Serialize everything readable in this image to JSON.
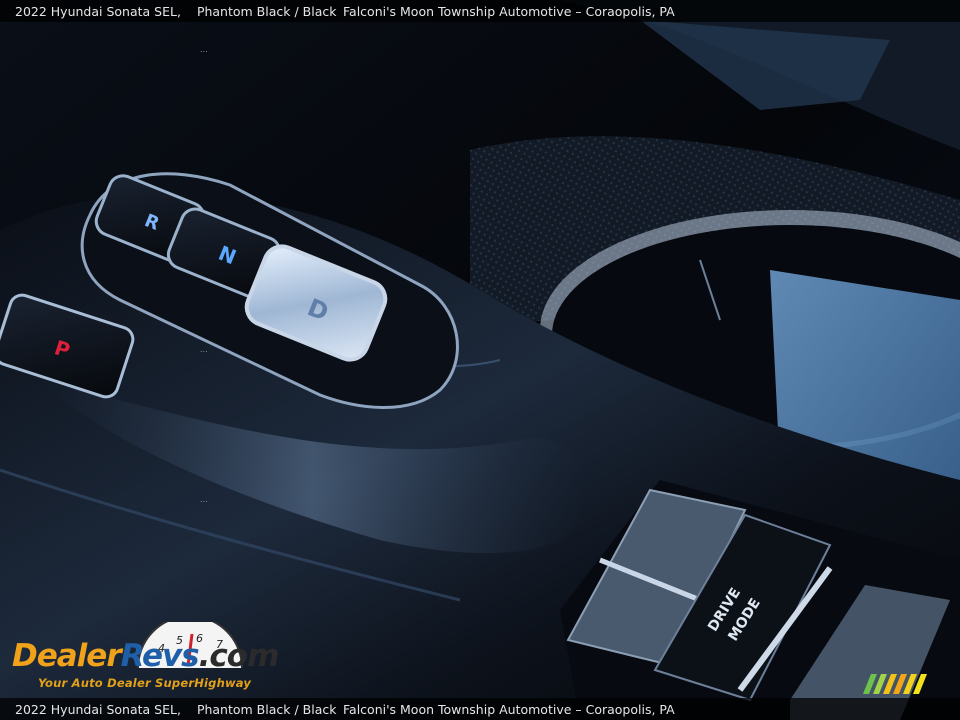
{
  "caption": {
    "vehicle": "2022 Hyundai Sonata SEL,",
    "color": "Phantom Black / Black",
    "dealer": "Falconi's Moon Township Automotive – Coraopolis, PA"
  },
  "shifter": {
    "buttons": [
      "R",
      "N",
      "D",
      "P"
    ],
    "drive_mode_label_line1": "DRIVE",
    "drive_mode_label_line2": "MODE"
  },
  "watermark": {
    "brand_part1": "Dealer",
    "brand_part2": "Revs",
    "brand_part3": ".com",
    "tagline": "Your Auto Dealer SuperHighway",
    "gauge_numbers": [
      "4",
      "5",
      "6",
      "7"
    ],
    "dots": "..."
  },
  "colors": {
    "accent_orange": "#f0a21a",
    "accent_blue": "#1f5fa8",
    "park_red": "#e0203a",
    "gear_blue": "#5aa8ff"
  }
}
